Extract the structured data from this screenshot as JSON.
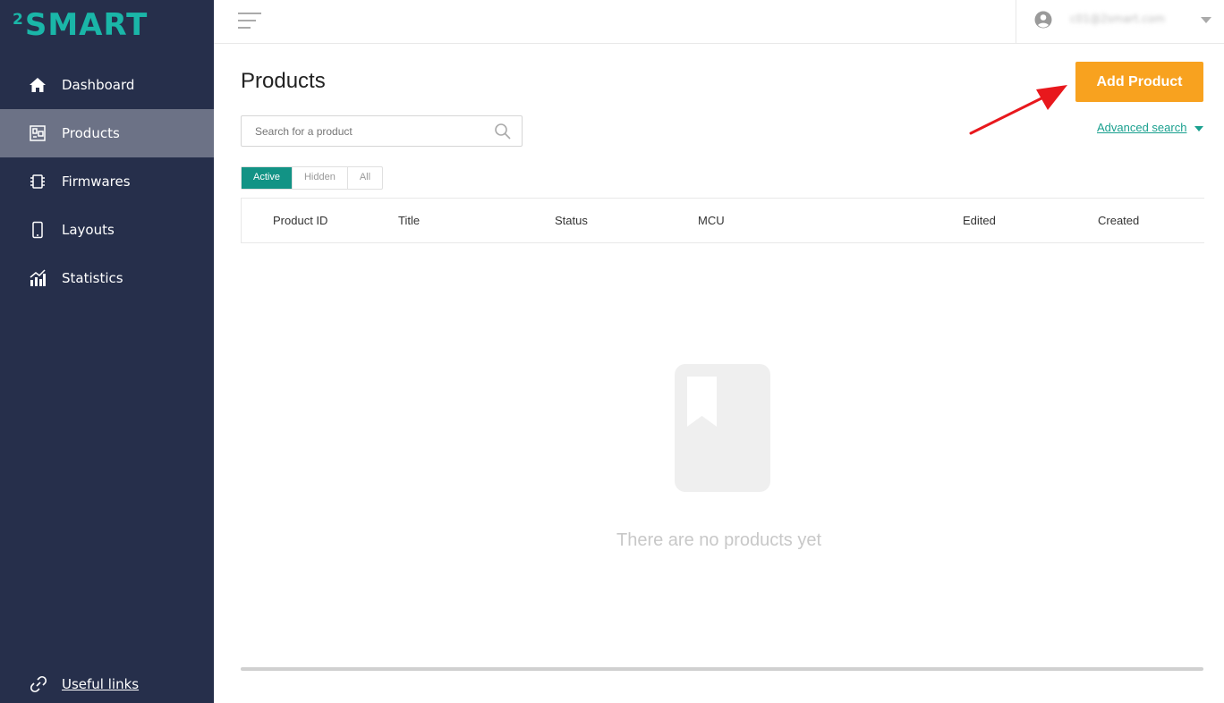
{
  "brand": {
    "logo_sup": "2",
    "logo_text": "SMART"
  },
  "sidebar": {
    "items": [
      {
        "label": "Dashboard",
        "icon": "home-icon",
        "active": false
      },
      {
        "label": "Products",
        "icon": "products-icon",
        "active": true
      },
      {
        "label": "Firmwares",
        "icon": "chip-icon",
        "active": false
      },
      {
        "label": "Layouts",
        "icon": "phone-icon",
        "active": false
      },
      {
        "label": "Statistics",
        "icon": "chart-icon",
        "active": false
      }
    ],
    "footer_link": "Useful links"
  },
  "header": {
    "user_email": "c01@2smart.com"
  },
  "main": {
    "title": "Products",
    "add_button": "Add Product",
    "search_placeholder": "Search for a product",
    "advanced_search": "Advanced search",
    "tabs": [
      {
        "label": "Active",
        "active": true
      },
      {
        "label": "Hidden",
        "active": false
      },
      {
        "label": "All",
        "active": false
      }
    ],
    "columns": [
      "Product ID",
      "Title",
      "Status",
      "MCU",
      "Edited",
      "Created"
    ],
    "empty_message": "There are no products yet"
  },
  "colors": {
    "sidebar_bg": "#262f4b",
    "sidebar_active": "#6c7286",
    "accent_teal": "#1ab6a8",
    "add_button": "#f8a21f",
    "annotation_arrow": "#e8181d"
  }
}
